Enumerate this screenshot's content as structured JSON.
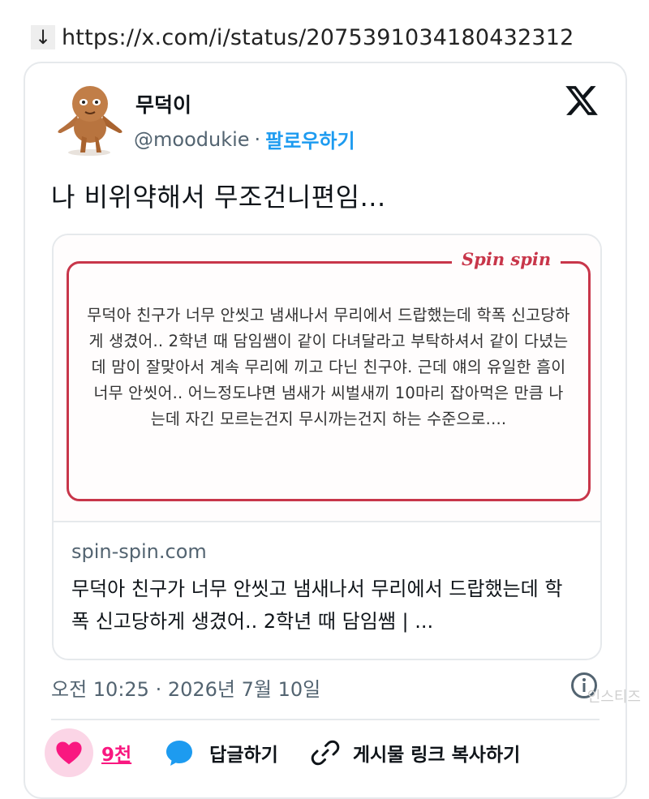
{
  "url_bar": {
    "icon": "download-arrow-icon",
    "arrow_glyph": "↓",
    "url": "https://x.com/i/status/2075391034180432312"
  },
  "author": {
    "name": "무덕이",
    "handle": "@moodukie",
    "separator": "·",
    "follow_label": "팔로우하기",
    "avatar_icon": "avatar-figurine"
  },
  "tweet": {
    "text": "나 비위약해서 무조건니편임..."
  },
  "link_card": {
    "brand": "Spin spin",
    "preview_text": "무덕아 친구가 너무 안씻고 냄새나서 무리에서 드랍했는데 학폭 신고당하게 생겼어.. 2학년 때 담임쌤이 같이 다녀달라고 부탁하셔서 같이 다녔는데 맘이 잘맞아서 계속 무리에 끼고 다닌 친구야. 근데 얘의 유일한 흠이 너무 안씻어.. 어느정도냐면 냄새가 씨벌새끼 10마리 잡아먹은 만큼 나는데 자긴 모르는건지 무시까는건지 하는 수준으로....",
    "domain": "spin-spin.com",
    "description": "무덕아 친구가 너무 안씻고 냄새나서 무리에서 드랍했는데 학폭 신고당하게 생겼어.. 2학년 때 담임쌤 | ..."
  },
  "meta": {
    "timestamp": "오전 10:25 · 2026년 7월 10일"
  },
  "actions": {
    "like_count": "9천",
    "reply_label": "답글하기",
    "copy_link_label": "게시물 링크 복사하기"
  },
  "watermark": "인스티즈",
  "colors": {
    "accent": "#1d9bf0",
    "like": "#f91880",
    "brand_red": "#c8364a"
  }
}
